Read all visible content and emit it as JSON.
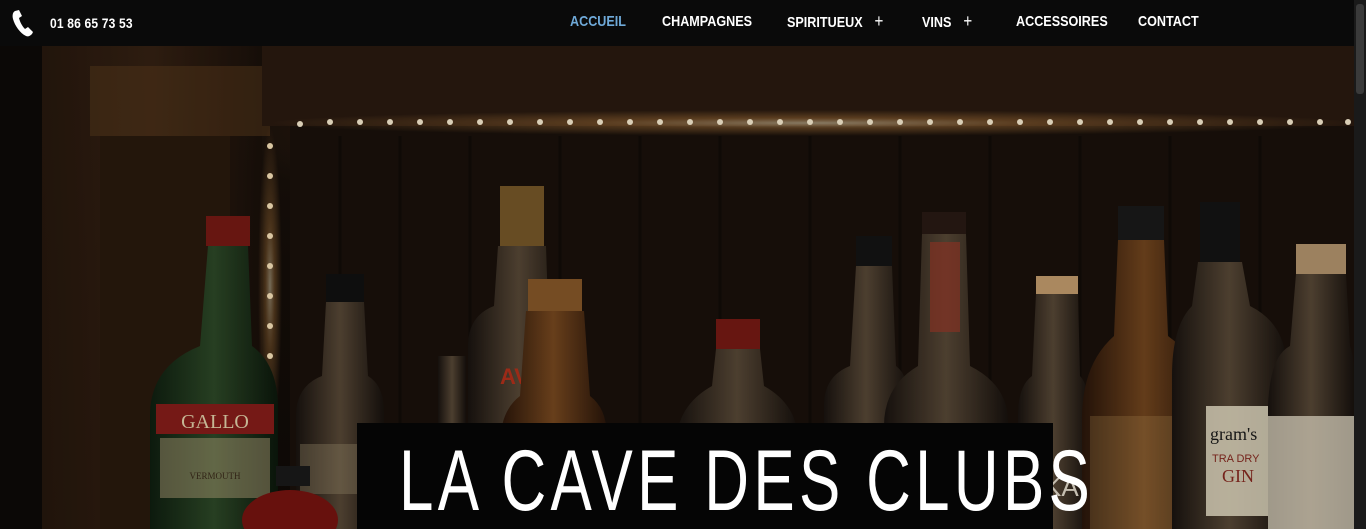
{
  "header": {
    "phone_icon": "phone-icon",
    "phone": "01 86 65 73 53"
  },
  "nav": {
    "items": [
      {
        "label": "ACCUEIL",
        "active": true,
        "has_submenu": false
      },
      {
        "label": "CHAMPAGNES",
        "active": false,
        "has_submenu": false
      },
      {
        "label": "SPIRITUEUX",
        "active": false,
        "has_submenu": true
      },
      {
        "label": "VINS",
        "active": false,
        "has_submenu": true
      },
      {
        "label": "ACCESSOIRES",
        "active": false,
        "has_submenu": false
      },
      {
        "label": "CONTACT",
        "active": false,
        "has_submenu": false
      }
    ],
    "submenu_symbol": "+",
    "active_color": "#6fa9d8"
  },
  "hero": {
    "image": "bar-shelf-bottles-photo",
    "bottle_labels": [
      "GALLO",
      "VERMOUTH",
      "gram's",
      "TRA DRY",
      "GIN",
      "AVE",
      "KA"
    ],
    "title": "LA CAVE DES CLUBS"
  }
}
